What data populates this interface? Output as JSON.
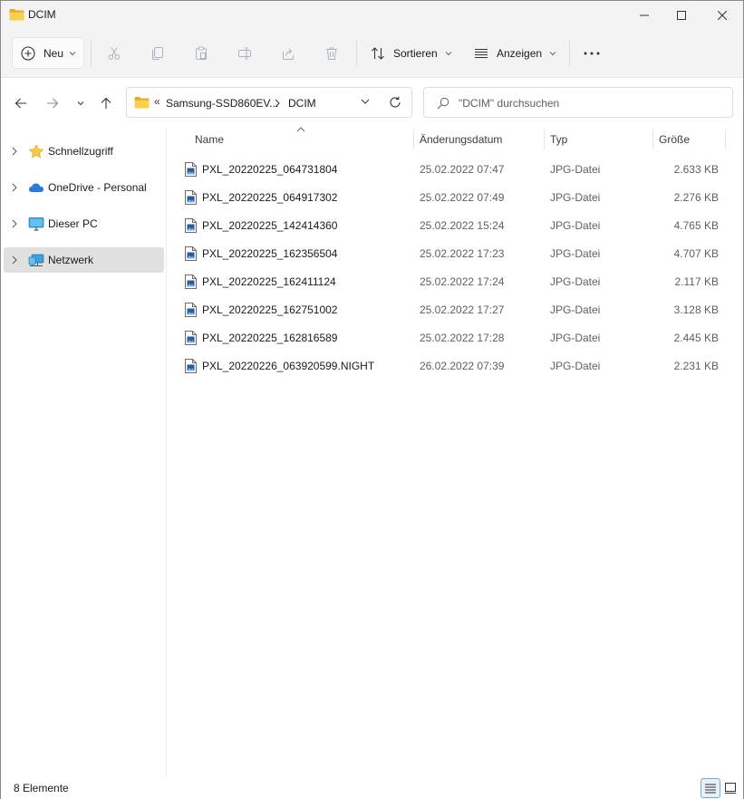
{
  "window": {
    "title": "DCIM",
    "title_icon": "folder-icon",
    "controls": [
      "minimize-icon",
      "maximize-icon",
      "close-icon"
    ]
  },
  "commandbar": {
    "new_label": "Neu",
    "sort_label": "Sortieren",
    "view_label": "Anzeigen",
    "tools": [
      "cut-icon",
      "copy-icon",
      "paste-icon",
      "rename-icon",
      "share-icon",
      "delete-icon"
    ],
    "more_icon": "more-icon"
  },
  "address": {
    "overflow": "«",
    "crumbs": [
      "Samsung-SSD860EV...",
      "DCIM"
    ]
  },
  "search": {
    "placeholder": "\"DCIM\" durchsuchen"
  },
  "sidebar": {
    "items": [
      {
        "label": "Schnellzugriff",
        "icon": "star-icon",
        "selected": false
      },
      {
        "label": "OneDrive - Personal",
        "icon": "cloud-icon",
        "selected": false
      },
      {
        "label": "Dieser PC",
        "icon": "computer-icon",
        "selected": false
      },
      {
        "label": "Netzwerk",
        "icon": "network-icon",
        "selected": true
      }
    ]
  },
  "columns": {
    "name": "Name",
    "date": "Änderungsdatum",
    "type": "Typ",
    "size": "Größe"
  },
  "files": [
    {
      "name": "PXL_20220225_064731804",
      "date": "25.02.2022 07:47",
      "type": "JPG-Datei",
      "size": "2.633 KB"
    },
    {
      "name": "PXL_20220225_064917302",
      "date": "25.02.2022 07:49",
      "type": "JPG-Datei",
      "size": "2.276 KB"
    },
    {
      "name": "PXL_20220225_142414360",
      "date": "25.02.2022 15:24",
      "type": "JPG-Datei",
      "size": "4.765 KB"
    },
    {
      "name": "PXL_20220225_162356504",
      "date": "25.02.2022 17:23",
      "type": "JPG-Datei",
      "size": "4.707 KB"
    },
    {
      "name": "PXL_20220225_162411124",
      "date": "25.02.2022 17:24",
      "type": "JPG-Datei",
      "size": "2.117 KB"
    },
    {
      "name": "PXL_20220225_162751002",
      "date": "25.02.2022 17:27",
      "type": "JPG-Datei",
      "size": "3.128 KB"
    },
    {
      "name": "PXL_20220225_162816589",
      "date": "25.02.2022 17:28",
      "type": "JPG-Datei",
      "size": "2.445 KB"
    },
    {
      "name": "PXL_20220226_063920599.NIGHT",
      "date": "26.02.2022 07:39",
      "type": "JPG-Datei",
      "size": "2.231 KB"
    }
  ],
  "status": {
    "count": "8 Elemente",
    "active_view": "details-view-icon"
  },
  "colors": {
    "folder": "#f5c542",
    "star": "#f7c948",
    "onedrive": "#2b7cd3",
    "accent": "#0067c0",
    "selection": "#e0e0e0"
  }
}
